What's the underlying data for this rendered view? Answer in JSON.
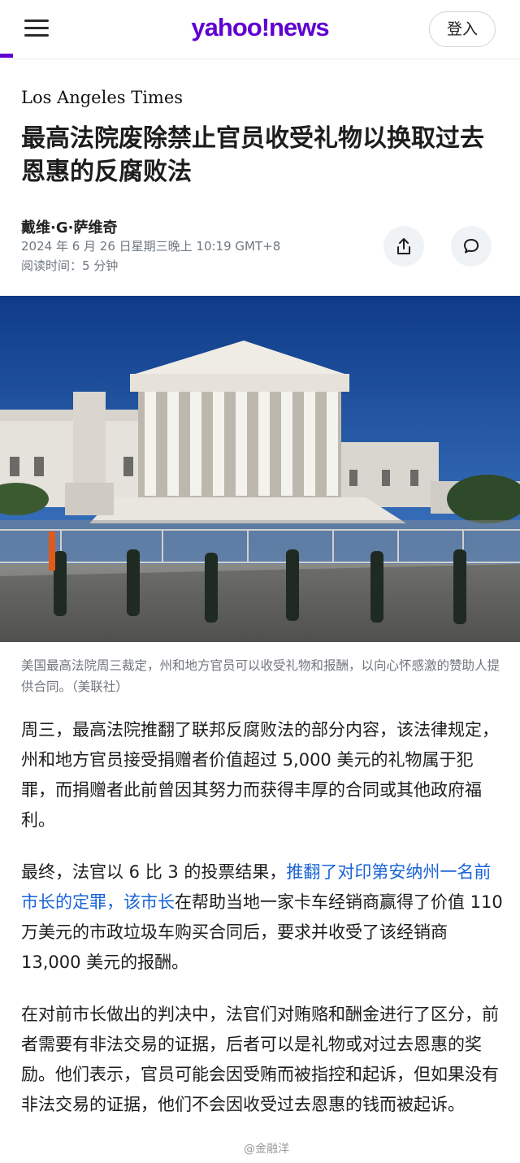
{
  "header": {
    "logo_text": "yahoo!news",
    "login_label": "登入",
    "brand_color": "#6001d2"
  },
  "article": {
    "source": "Los Angeles Times",
    "headline": "最高法院废除禁止官员收受礼物以换取过去恩惠的反腐败法",
    "author": "戴维·G·萨维奇",
    "date": "2024 年 6 月 26 日星期三晚上 10:19 GMT+8",
    "read_time": "阅读时间：5 分钟",
    "caption": "美国最高法院周三裁定，州和地方官员可以收受礼物和报酬，以向心怀感激的赞助人提供合同。（美联社）",
    "para1": "周三，最高法院推翻了联邦反腐败法的部分内容，该法律规定，州和地方官员接受捐赠者价值超过 5,000 美元的礼物属于犯罪，而捐赠者此前曾因其努力而获得丰厚的合同或其他政府福利。",
    "para2_before": "最终，法官以 6 比 3 的投票结果，",
    "para2_link1": "推翻了对印第安纳州一名前市长的定罪",
    "para2_mid": "，",
    "para2_link2": "该市长",
    "para2_after": "在帮助当地一家卡车经销商赢得了价值 110 万美元的市政垃圾车购买合同后，要求并收受了该经销商 13,000 美元的报酬。",
    "para3": "在对前市长做出的判决中，法官们对贿赂和酬金进行了区分，前者需要有非法交易的证据，后者可以是礼物或对过去恩惠的奖励。他们表示，官员可能会因受贿而被指控和起诉，但如果没有非法交易的证据，他们不会因收受过去恩惠的钱而被起诉。"
  },
  "actions": {
    "share_icon": "share-icon",
    "comment_icon": "comment-icon"
  },
  "watermark": "@金融洋"
}
